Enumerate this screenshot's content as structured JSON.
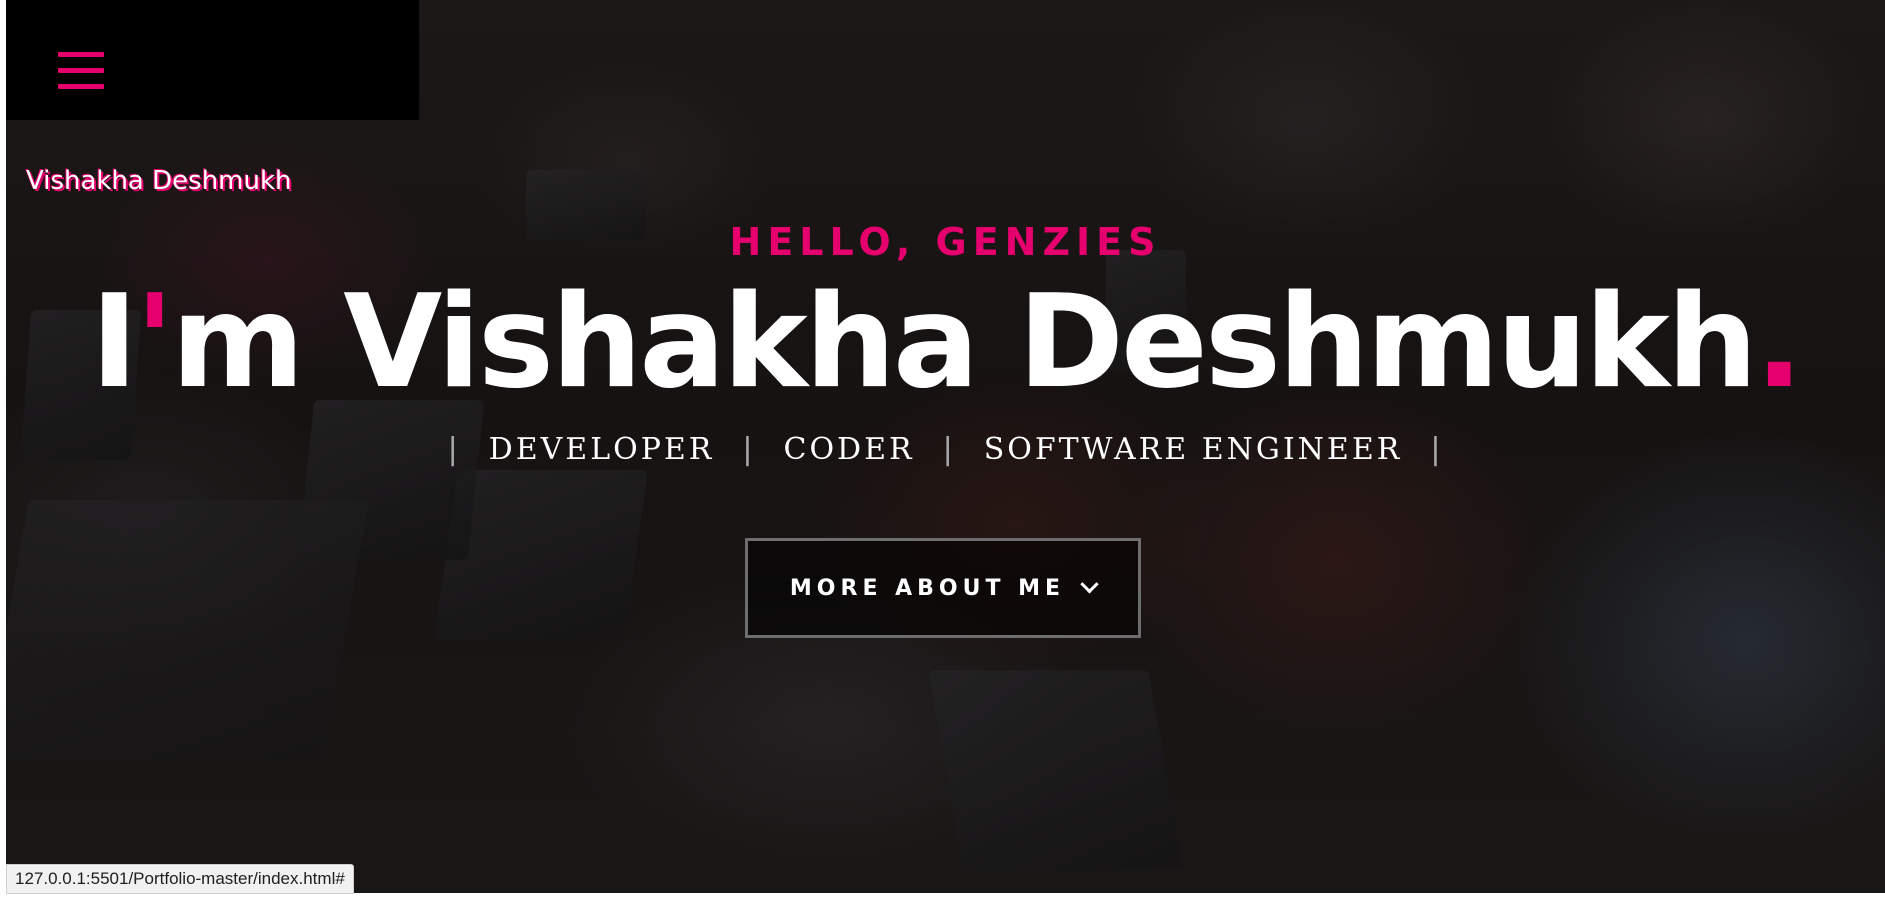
{
  "brand": {
    "logo_text": "Vishakha Deshmukh",
    "accent_color": "#e6006e"
  },
  "header": {
    "menu_icon": "hamburger-menu-icon"
  },
  "hero": {
    "greeting": "HELLO, GENZIES",
    "name_prefix": "I",
    "name_apostrophe": "'",
    "name_body": "m Vishakha Deshmukh",
    "name_period": ".",
    "roles": [
      "DEVELOPER",
      "CODER",
      "SOFTWARE ENGINEER"
    ],
    "separator": "|",
    "cta_label": "MORE ABOUT ME",
    "cta_icon": "chevron-down-icon"
  },
  "status_bar": {
    "link_url": "127.0.0.1:5501/Portfolio-master/index.html#"
  }
}
